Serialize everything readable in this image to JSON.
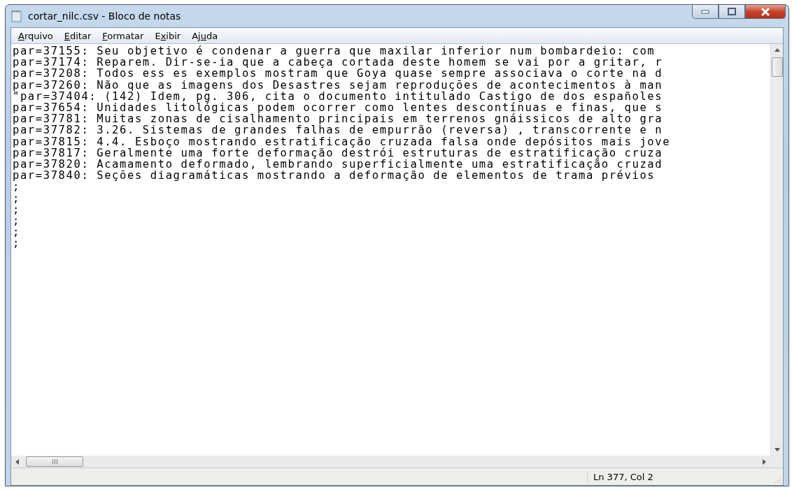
{
  "window": {
    "title": "cortar_nilc.csv - Bloco de notas"
  },
  "menu": [
    {
      "label": "Arquivo"
    },
    {
      "label": "Editar"
    },
    {
      "label": "Formatar"
    },
    {
      "label": "Exibir"
    },
    {
      "label": "Ajuda"
    }
  ],
  "lines": [
    "par=37155: Seu objetivo é condenar a guerra que maxilar inferior num bombardeio: com",
    "par=37174: Reparem. Dir-se-ia que a cabeça cortada deste homem se vai por a gritar, r",
    "par=37208: Todos ess es exemplos mostram que Goya quase sempre associava o corte na d",
    "par=37260: Não que as imagens dos Desastres sejam reproduções de acontecimentos à man",
    "\"par=37404: (142) Idem, pg. 306, cita o documento intitulado Castigo de dos españoles",
    "par=37654: Unidades litológicas podem ocorrer como lentes descontínuas e finas, que s",
    "par=37781: Muitas zonas de cisalhamento principais em terrenos gnáissicos de alto gra",
    "par=37782: 3.26. Sistemas de grandes falhas de empurrão (reversa) , transcorrente e n",
    "par=37815: 4.4. Esboço mostrando estratificação cruzada falsa onde depósitos mais jove",
    "par=37817: Geralmente uma forte deformação destrói estruturas de estratificação cruza",
    "par=37820: Acamamento deformado, lembrando superficialmente uma estratificação cruzad",
    "par=37840: Seções diagramáticas mostrando a deformação de elementos de trama prévios",
    ";",
    ";",
    ";",
    ";",
    ";",
    ";"
  ],
  "status_bar": {
    "position": "Ln 377, Col 2"
  }
}
